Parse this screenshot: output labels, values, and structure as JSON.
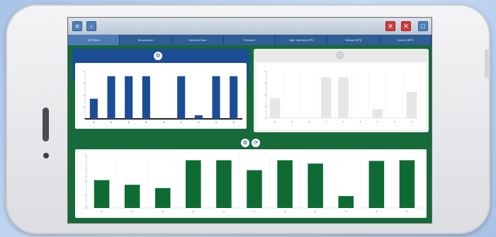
{
  "toolbar": {
    "left_buttons": [
      "menu-icon",
      "back-icon"
    ],
    "right_buttons": [
      "close-icon",
      "close-icon",
      "window-icon"
    ]
  },
  "tabs": [
    {
      "label": "KPI View"
    },
    {
      "label": "Temperature"
    },
    {
      "label": "Humidity Data"
    },
    {
      "label": "Pressure"
    },
    {
      "label": "Light Intensity (KPI)"
    },
    {
      "label": "Voltage (KPI)"
    },
    {
      "label": "Current (KPI)"
    }
  ],
  "colors": {
    "blue_bar": "#1c4c96",
    "gray_bar": "#e6e6e6",
    "green_bar": "#0e6b33",
    "screen_green": "#176a3a",
    "blue_header": "#1c4c96"
  },
  "chart_data": [
    {
      "type": "bar",
      "categories": [
        "",
        "",
        "",
        "",
        "",
        "",
        "",
        "",
        ""
      ],
      "values": [
        34,
        72,
        72,
        72,
        0,
        72,
        6,
        72,
        72
      ],
      "ylim": [
        0,
        80
      ]
    },
    {
      "type": "bar",
      "categories": [
        "",
        "",
        "",
        "",
        "",
        "",
        "",
        "",
        ""
      ],
      "values": [
        34,
        0,
        0,
        70,
        70,
        0,
        15,
        0,
        45
      ],
      "ylim": [
        0,
        80
      ]
    },
    {
      "type": "bar",
      "categories": [
        "",
        "",
        "",
        "",
        "",
        "",
        "",
        "",
        "",
        "",
        ""
      ],
      "values": [
        42,
        35,
        30,
        72,
        72,
        57,
        72,
        67,
        18,
        71,
        72
      ],
      "ylim": [
        0,
        80
      ]
    }
  ]
}
